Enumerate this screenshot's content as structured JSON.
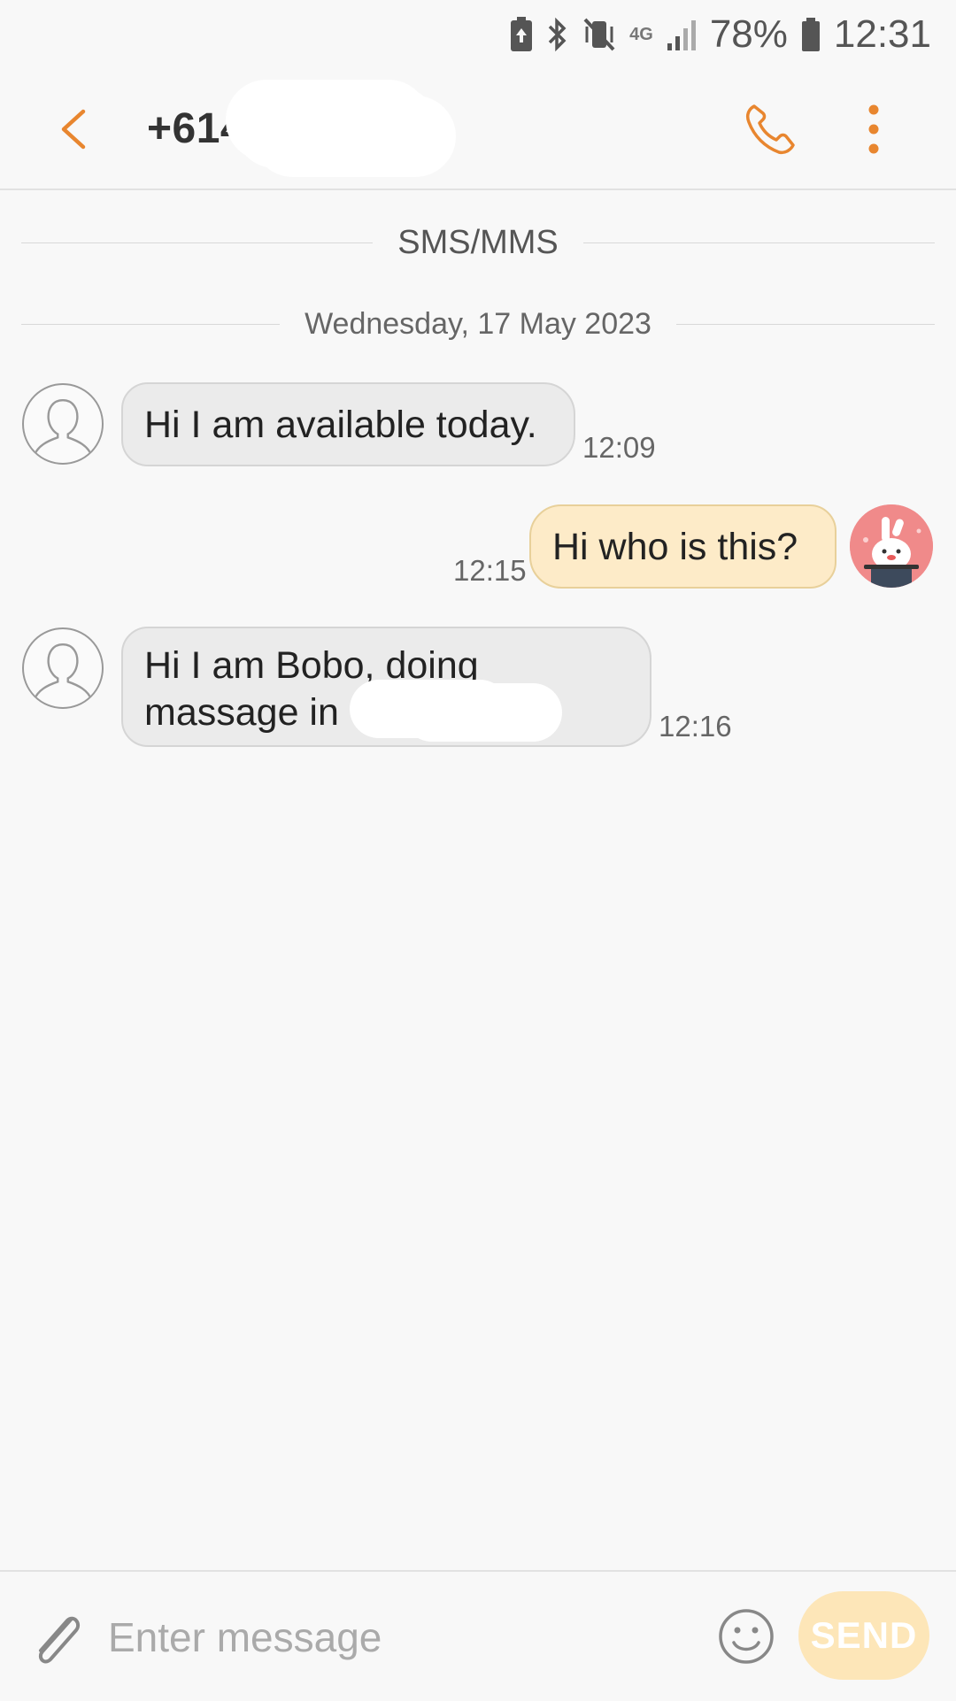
{
  "status_bar": {
    "network": "4G",
    "battery_percent": "78%",
    "time": "12:31",
    "icons": [
      "battery-saver-icon",
      "bluetooth-icon",
      "vibrate-mute-icon",
      "network-4g-icon",
      "signal-icon",
      "battery-icon"
    ]
  },
  "header": {
    "contact": "+614",
    "back_icon": "chevron-left-icon",
    "call_icon": "phone-icon",
    "more_icon": "more-vert-icon",
    "accent": "#e8862f"
  },
  "conversation": {
    "channel_label": "SMS/MMS",
    "date_label": "Wednesday, 17 May 2023",
    "messages": [
      {
        "direction": "incoming",
        "text": "Hi I am available today.",
        "time": "12:09"
      },
      {
        "direction": "outgoing",
        "text": "Hi who is this?",
        "time": "12:15"
      },
      {
        "direction": "incoming",
        "line1": "Hi I am Bobo, doing",
        "line2": "massage in",
        "time": "12:16"
      }
    ]
  },
  "composer": {
    "placeholder": "Enter message",
    "value": "",
    "send_label": "SEND",
    "attach_icon": "paperclip-icon",
    "emoji_icon": "emoji-icon"
  },
  "colors": {
    "incoming_bubble": "#ebebeb",
    "outgoing_bubble": "#fdebc8",
    "send_disabled": "#fde6b8",
    "background": "#f8f8f8"
  }
}
